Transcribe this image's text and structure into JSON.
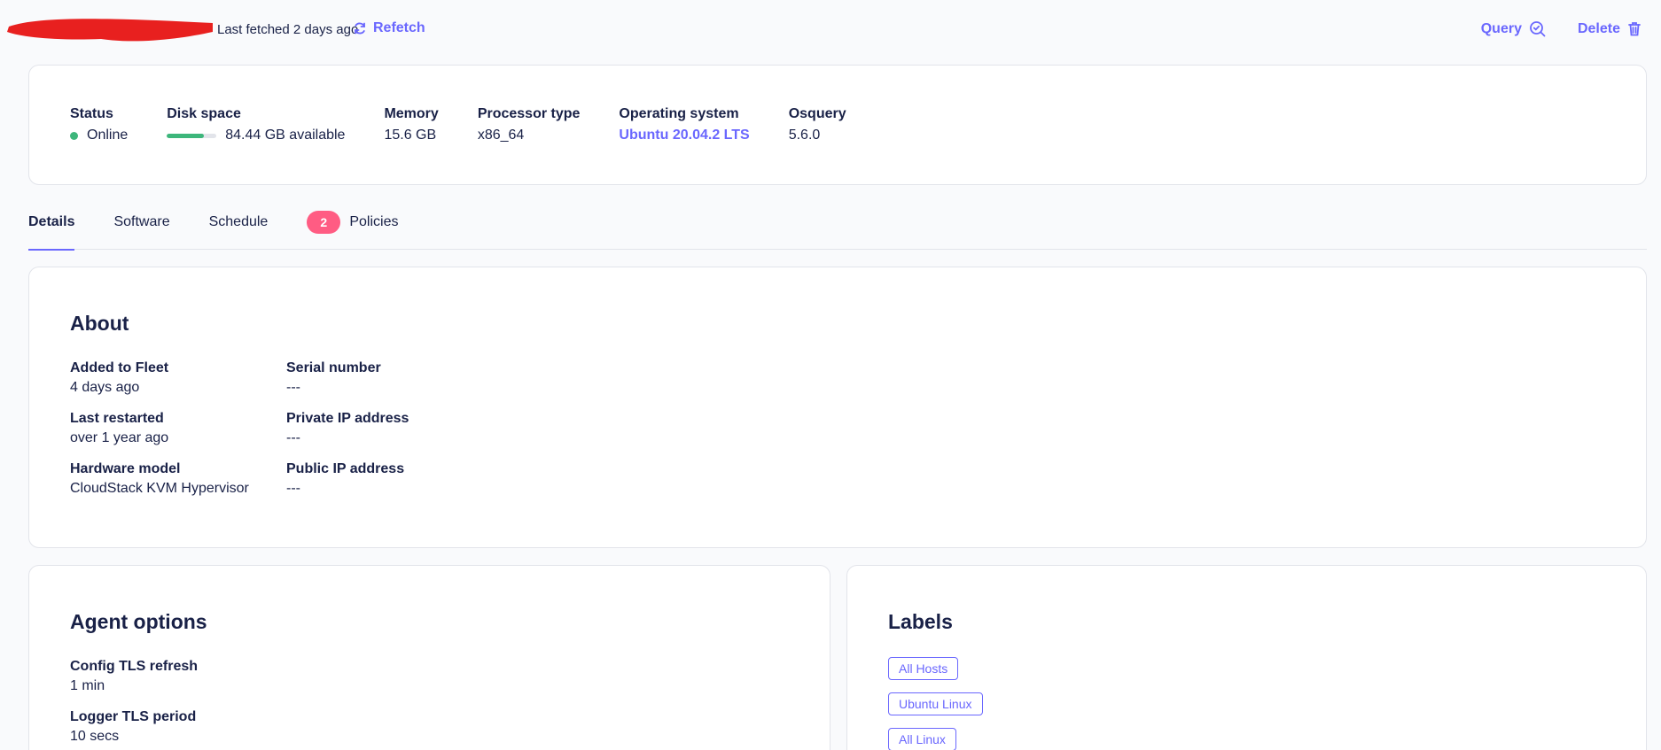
{
  "header": {
    "fetched_text": "Last fetched 2 days ago",
    "refetch_label": "Refetch",
    "query_label": "Query",
    "delete_label": "Delete"
  },
  "summary": {
    "status": {
      "label": "Status",
      "value": "Online",
      "color": "#3db67b"
    },
    "disk": {
      "label": "Disk space",
      "value": "84.44 GB available",
      "used_fraction": 0.75
    },
    "memory": {
      "label": "Memory",
      "value": "15.6 GB"
    },
    "processor": {
      "label": "Processor type",
      "value": "x86_64"
    },
    "os": {
      "label": "Operating system",
      "value": "Ubuntu 20.04.2 LTS"
    },
    "osquery": {
      "label": "Osquery",
      "value": "5.6.0"
    }
  },
  "tabs": {
    "details": "Details",
    "software": "Software",
    "schedule": "Schedule",
    "policies": "Policies",
    "policies_count": "2"
  },
  "about": {
    "title": "About",
    "added_label": "Added to Fleet",
    "added_value": "4 days ago",
    "serial_label": "Serial number",
    "serial_value": "---",
    "restarted_label": "Last restarted",
    "restarted_value": "over 1 year ago",
    "private_ip_label": "Private IP address",
    "private_ip_value": "---",
    "hardware_label": "Hardware model",
    "hardware_value": "CloudStack KVM Hypervisor",
    "public_ip_label": "Public IP address",
    "public_ip_value": "---"
  },
  "agent_options": {
    "title": "Agent options",
    "config_label": "Config TLS refresh",
    "config_value": "1 min",
    "logger_label": "Logger TLS period",
    "logger_value": "10 secs"
  },
  "labels": {
    "title": "Labels",
    "items": [
      "All Hosts",
      "Ubuntu Linux",
      "All Linux"
    ]
  },
  "colors": {
    "accent": "#6a67fe",
    "badge": "#ff5c83",
    "redaction": "#e8201f"
  },
  "icons": [
    "refresh-icon",
    "query-icon",
    "trash-icon"
  ]
}
